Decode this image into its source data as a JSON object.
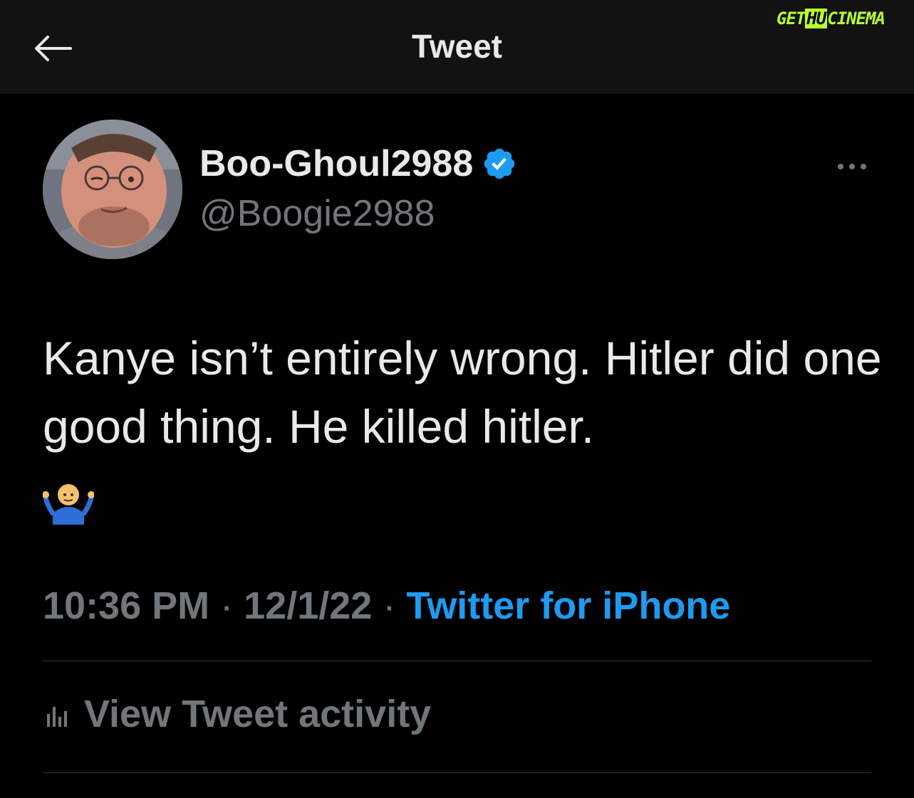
{
  "header": {
    "title": "Tweet",
    "back_icon": "arrow-left-icon"
  },
  "watermark": {
    "part_a": "GET",
    "part_b": "HU",
    "part_c": "CINEMA",
    "color": "#b9ff2f"
  },
  "tweet": {
    "author_name": "Boo-Ghoul2988",
    "verified_icon": "verified-badge-icon",
    "handle": "@Boogie2988",
    "more_icon": "more-horizontal-icon",
    "text": "Kanye isn’t entirely wrong. Hitler did one good thing. He killed hitler.",
    "emoji": "man-shrugging-emoji",
    "time": "10:36 PM",
    "separator": "·",
    "date": "12/1/22",
    "source": "Twitter for iPhone",
    "activity_label": "View Tweet activity",
    "activity_icon": "bar-chart-icon"
  },
  "colors": {
    "background": "#000000",
    "header_bg": "#121212",
    "primary_text": "#e7e9ea",
    "secondary_text": "#71767b",
    "accent": "#1d9bf0",
    "divider": "#2f3336"
  }
}
